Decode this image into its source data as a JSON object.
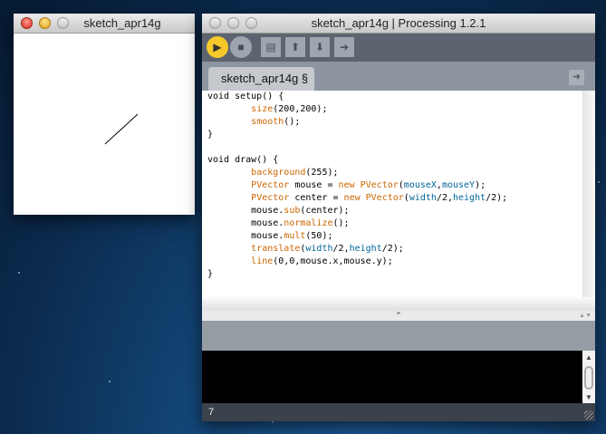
{
  "sketch_window": {
    "title": "sketch_apr14g"
  },
  "main_window": {
    "title": "sketch_apr14g | Processing 1.2.1",
    "toolbar": {
      "icons": [
        "run-icon",
        "stop-icon",
        "new-icon",
        "open-icon",
        "save-icon",
        "export-icon"
      ]
    },
    "tab": {
      "label": "sketch_apr14g §"
    },
    "code": [
      [
        [
          "void setup() {",
          ""
        ]
      ],
      [
        [
          "        ",
          ""
        ],
        [
          "size",
          "k"
        ],
        [
          "(200,200);",
          ""
        ]
      ],
      [
        [
          "        ",
          ""
        ],
        [
          "smooth",
          "k"
        ],
        [
          "();",
          ""
        ]
      ],
      [
        [
          "}",
          ""
        ]
      ],
      [
        [
          "",
          ""
        ]
      ],
      [
        [
          "void draw() {",
          ""
        ]
      ],
      [
        [
          "        ",
          ""
        ],
        [
          "background",
          "k"
        ],
        [
          "(255);",
          ""
        ]
      ],
      [
        [
          "        ",
          ""
        ],
        [
          "PVector",
          "k"
        ],
        [
          " mouse = ",
          ""
        ],
        [
          "new",
          "k"
        ],
        [
          " ",
          ""
        ],
        [
          "PVector",
          "k"
        ],
        [
          "(",
          ""
        ],
        [
          "mouseX",
          "v"
        ],
        [
          ",",
          ""
        ],
        [
          "mouseY",
          "v"
        ],
        [
          ");",
          ""
        ]
      ],
      [
        [
          "        ",
          ""
        ],
        [
          "PVector",
          "k"
        ],
        [
          " center = ",
          ""
        ],
        [
          "new",
          "k"
        ],
        [
          " ",
          ""
        ],
        [
          "PVector",
          "k"
        ],
        [
          "(",
          ""
        ],
        [
          "width",
          "v"
        ],
        [
          "/2,",
          ""
        ],
        [
          "height",
          "v"
        ],
        [
          "/2);",
          ""
        ]
      ],
      [
        [
          "        mouse.",
          ""
        ],
        [
          "sub",
          "k"
        ],
        [
          "(center);",
          ""
        ]
      ],
      [
        [
          "        mouse.",
          ""
        ],
        [
          "normalize",
          "k"
        ],
        [
          "();",
          ""
        ]
      ],
      [
        [
          "        mouse.",
          ""
        ],
        [
          "mult",
          "k"
        ],
        [
          "(50);",
          ""
        ]
      ],
      [
        [
          "        ",
          ""
        ],
        [
          "translate",
          "k"
        ],
        [
          "(",
          ""
        ],
        [
          "width",
          "v"
        ],
        [
          "/2,",
          ""
        ],
        [
          "height",
          "v"
        ],
        [
          "/2);",
          ""
        ]
      ],
      [
        [
          "        ",
          ""
        ],
        [
          "line",
          "k"
        ],
        [
          "(0,0,mouse.x,mouse.y);",
          ""
        ]
      ],
      [
        [
          "}",
          ""
        ]
      ]
    ],
    "status": {
      "line_number": "7"
    }
  }
}
